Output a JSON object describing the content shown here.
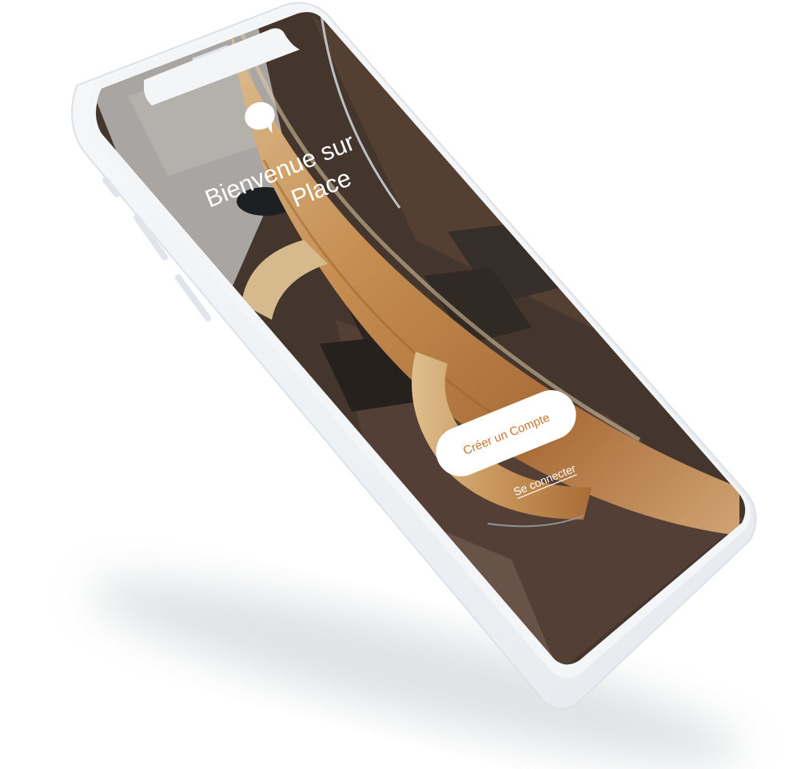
{
  "welcome": {
    "line1": "Bienvenue sur",
    "line2": "Place"
  },
  "actions": {
    "create_account_label": "Créer un Compte",
    "login_label": "Se connecter"
  },
  "colors": {
    "device_frame": "#eef1f4",
    "accent_orange": "#c8742e",
    "button_bg": "#ffffff",
    "wood_light": "#e3b57e",
    "wood_dark": "#8d5a2e",
    "stair_dark": "#3e342d"
  },
  "icons": {
    "logo": "speech-bubble-logo"
  }
}
